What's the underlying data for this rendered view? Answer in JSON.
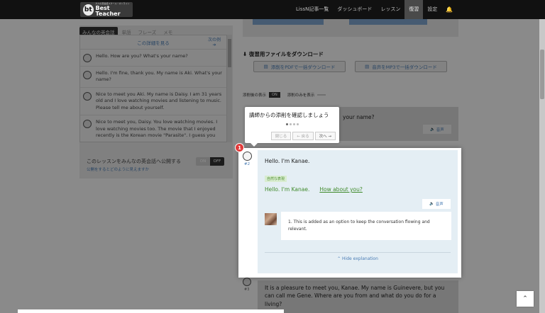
{
  "header": {
    "logo_tagline": "大人の英会話スクール・オンライン",
    "logo_text": "Best Teacher",
    "nav": [
      "LissN記事一覧",
      "ダッシュボード",
      "レッスン",
      "復習",
      "設定"
    ],
    "nav_active_index": 3
  },
  "left_panel": {
    "tabs": [
      "みんなの英会話",
      "単語",
      "フレーズ",
      "メモ"
    ],
    "active_tab": 0,
    "detail_link": "この詳細を見る",
    "next_label": "次の例",
    "messages": [
      "Hello. How are you? What's your name?",
      "Hello. I'm fine, thank you. My name is Aki. What's your name?",
      "Nice to meet you Aki. My name is Daisy. I am 31 years old and I love watching movies and listening to music. Please tell me about yourself.",
      "Nice to meet you, Daisy. You love watching movies. I love watching movies too. The movie that I enjoyed recently is the Korean movie \"Parasite\". I guess you"
    ],
    "publish_title": "このレッスンをみんなの英会話へ公開する",
    "publish_link": "公開をするとどのように見えますか",
    "toggle_on": "ON",
    "toggle_off": "OFF"
  },
  "right_panel": {
    "download_title": "復習用ファイルをダウンロード",
    "pdf_button": "添削をPDFで一括ダウンロード",
    "mp3_button": "音声をMP3で一括ダウンロード",
    "show_correction_label": "添削後の表示",
    "show_correction_value": "ON",
    "show_correction_only_label": "添削のみを表示",
    "bg_message": "your name?",
    "audio_label": "音声",
    "bottom_message": "It is a pleasure to meet you, Kanae. My name is Guinevere, but you can call me Gene. Where are you from and what do you do for a living?",
    "bottom_avatar_num": "#3"
  },
  "card": {
    "badge": "1",
    "avatar_num": "#2",
    "message": "Hello. I'm Kanae.",
    "tag": "自然な表現",
    "corrected_text": "Hello. I'm Kanae.",
    "corrected_fix": "How about you?",
    "audio_label": "音声",
    "explanation": "1. This is added as an option to keep the conversation flowing and relevant.",
    "hide_label": "⌃ Hide explanation"
  },
  "tour": {
    "title": "講師からの添削を確認しましょう",
    "step_current": 1,
    "step_total": 4,
    "close_label": "閉じる",
    "back_label": "← 戻る",
    "next_label": "次へ →"
  }
}
